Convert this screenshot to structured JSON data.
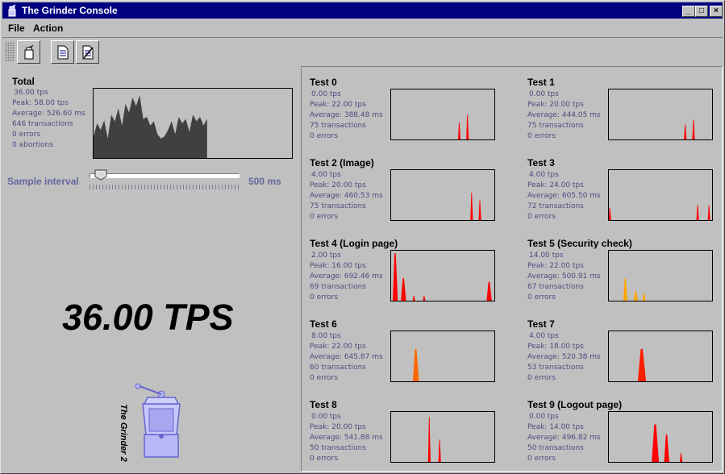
{
  "window": {
    "title": "The Grinder Console",
    "controls": {
      "minimize": "_",
      "maximize": "□",
      "close": "×"
    }
  },
  "menu": {
    "items": [
      "File",
      "Action"
    ]
  },
  "toolbar": {
    "buttons": [
      {
        "icon": "grinder-start-icon"
      },
      {
        "icon": "document-icon"
      },
      {
        "icon": "document-edit-icon"
      }
    ]
  },
  "total": {
    "title": "Total",
    "tps": "36.00 tps",
    "peak": "Peak: 58.00 tps",
    "average": "Average: 526.60 ms",
    "transactions": "646 transactions",
    "errors": "0 errors",
    "abortions": "0 abortions",
    "history": [
      20,
      32,
      26,
      35,
      18,
      40,
      34,
      46,
      30,
      50,
      42,
      56,
      48,
      58,
      36,
      38,
      30,
      34,
      22,
      18,
      20,
      26,
      34,
      22,
      38,
      32,
      36,
      24,
      40,
      34,
      38,
      30,
      36
    ]
  },
  "sample": {
    "label": "Sample interval",
    "value": "500 ms",
    "position": 0.04
  },
  "big_tps": "36.00 TPS",
  "logo": {
    "text": "The Grinder 2"
  },
  "tests": [
    {
      "title": "Test 0",
      "tps": "0.00 tps",
      "peak": "Peak: 22.00 tps",
      "average": "Average: 388.48 ms",
      "transactions": "75 transactions",
      "errors": "0 errors",
      "color": "#ff0000",
      "spikes": [
        [
          0.66,
          0.35,
          0.02
        ],
        [
          0.74,
          0.5,
          0.025
        ]
      ]
    },
    {
      "title": "Test 1",
      "tps": "0.00 tps",
      "peak": "Peak: 20.00 tps",
      "average": "Average: 444.05 ms",
      "transactions": "75 transactions",
      "errors": "0 errors",
      "color": "#ff0000",
      "spikes": [
        [
          0.74,
          0.3,
          0.025
        ],
        [
          0.82,
          0.4,
          0.025
        ]
      ]
    },
    {
      "title": "Test 2 (Image)",
      "tps": "4.00 tps",
      "peak": "Peak: 20.00 tps",
      "average": "Average: 460.53 ms",
      "transactions": "75 transactions",
      "errors": "0 errors",
      "color": "#ff0000",
      "spikes": [
        [
          0.78,
          0.55,
          0.025
        ],
        [
          0.86,
          0.4,
          0.025
        ]
      ]
    },
    {
      "title": "Test 3",
      "tps": "4.00 tps",
      "peak": "Peak: 24.00 tps",
      "average": "Average: 605.50 ms",
      "transactions": "72 transactions",
      "errors": "0 errors",
      "color": "#ff0000",
      "spikes": [
        [
          0.01,
          0.25,
          0.02
        ],
        [
          0.86,
          0.3,
          0.025
        ],
        [
          0.97,
          0.3,
          0.02
        ]
      ]
    },
    {
      "title": "Test 4 (Login page)",
      "tps": "2.00 tps",
      "peak": "Peak: 16.00 tps",
      "average": "Average: 692.46 ms",
      "transactions": "69 transactions",
      "errors": "0 errors",
      "color": "#ff0000",
      "spikes": [
        [
          0.04,
          0.95,
          0.05
        ],
        [
          0.12,
          0.45,
          0.05
        ],
        [
          0.22,
          0.1,
          0.01
        ],
        [
          0.32,
          0.1,
          0.01
        ],
        [
          0.95,
          0.38,
          0.05
        ]
      ]
    },
    {
      "title": "Test 5 (Security check)",
      "tps": "14.00 tps",
      "peak": "Peak: 22.00 tps",
      "average": "Average: 500.91 ms",
      "transactions": "67 transactions",
      "errors": "0 errors",
      "color": "#ffa500",
      "spikes": [
        [
          0.16,
          0.45,
          0.04
        ],
        [
          0.26,
          0.2,
          0.04
        ],
        [
          0.34,
          0.15,
          0.03
        ]
      ]
    },
    {
      "title": "Test 6",
      "tps": "8.00 tps",
      "peak": "Peak: 22.00 tps",
      "average": "Average: 645.87 ms",
      "transactions": "60 transactions",
      "errors": "0 errors",
      "color": "#ff6a00",
      "spikes": [
        [
          0.24,
          0.65,
          0.06
        ]
      ]
    },
    {
      "title": "Test 7",
      "tps": "4.00 tps",
      "peak": "Peak: 18.00 tps",
      "average": "Average: 520.38 ms",
      "transactions": "53 transactions",
      "errors": "0 errors",
      "color": "#ff2000",
      "spikes": [
        [
          0.32,
          0.65,
          0.08
        ]
      ]
    },
    {
      "title": "Test 8",
      "tps": "0.00 tps",
      "peak": "Peak: 20.00 tps",
      "average": "Average: 541.88 ms",
      "transactions": "50 transactions",
      "errors": "0 errors",
      "color": "#ff0000",
      "spikes": [
        [
          0.37,
          0.9,
          0.025
        ],
        [
          0.47,
          0.45,
          0.025
        ]
      ]
    },
    {
      "title": "Test 9 (Logout page)",
      "tps": "0.00 tps",
      "peak": "Peak: 14.00 tps",
      "average": "Average: 496.82 ms",
      "transactions": "50 transactions",
      "errors": "0 errors",
      "color": "#ff0000",
      "spikes": [
        [
          0.45,
          0.75,
          0.07
        ],
        [
          0.56,
          0.55,
          0.05
        ],
        [
          0.7,
          0.18,
          0.025
        ]
      ]
    }
  ]
}
